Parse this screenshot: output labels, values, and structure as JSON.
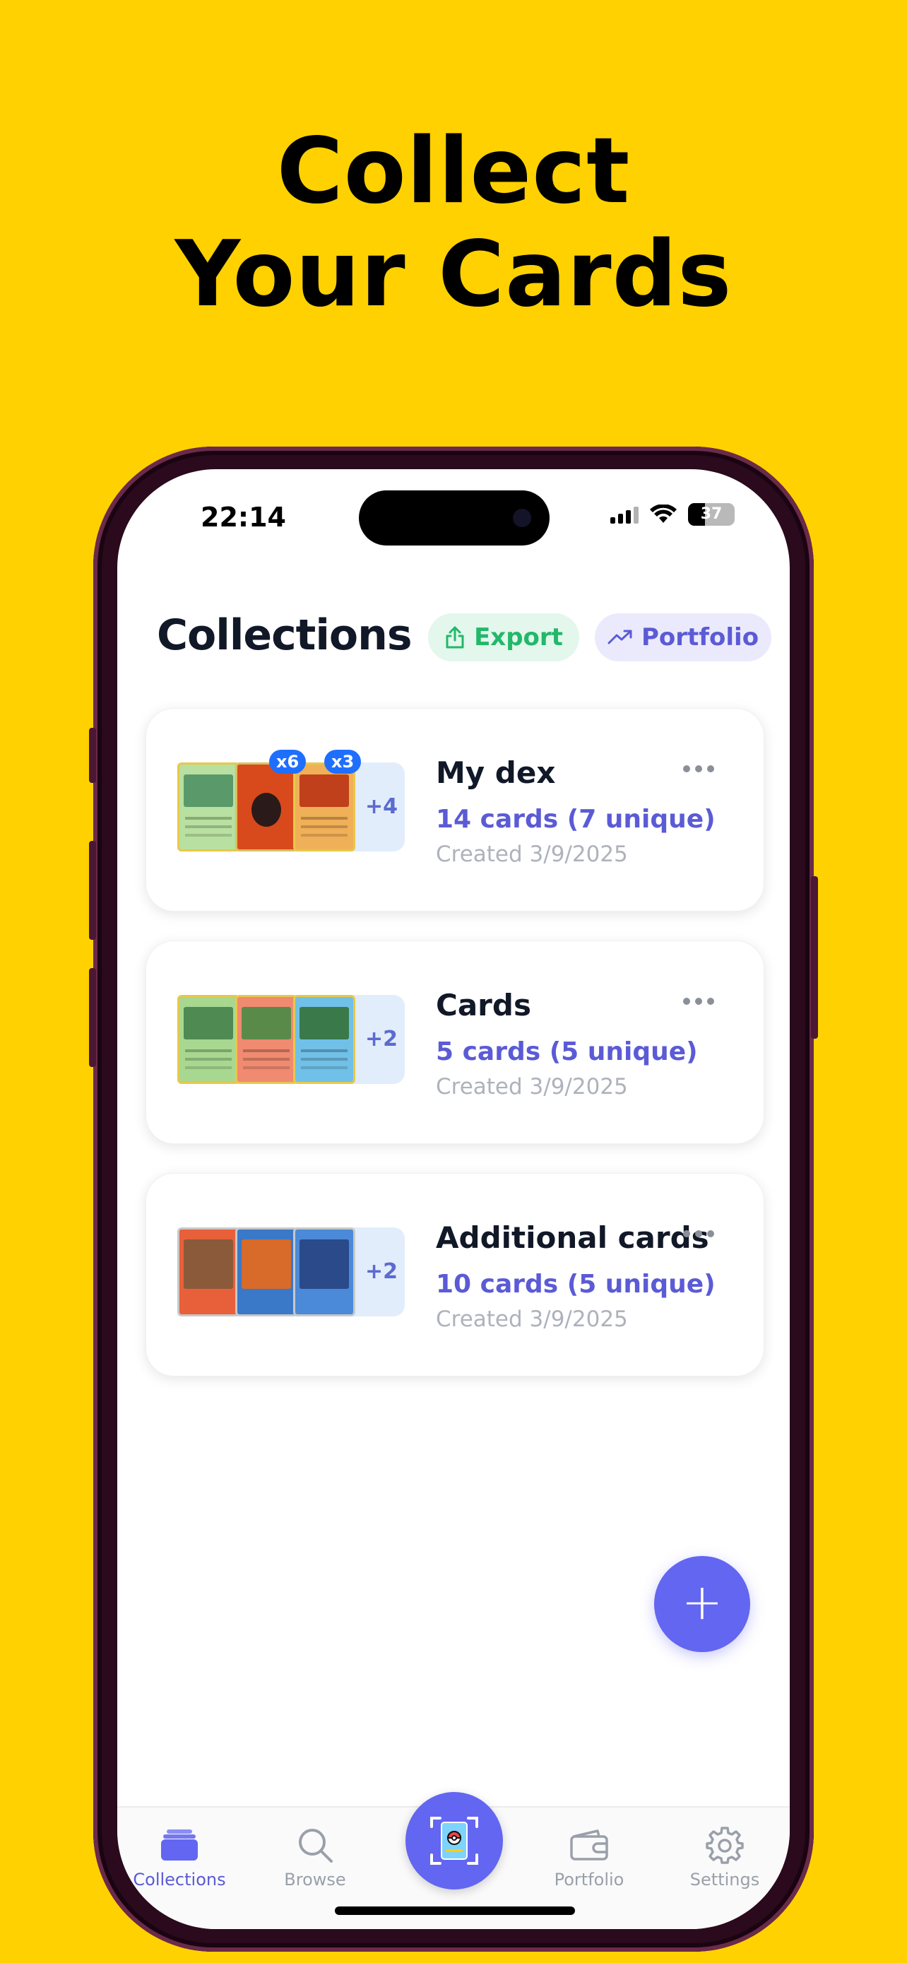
{
  "headline": {
    "line1": "Collect",
    "line2": "Your Cards"
  },
  "status_bar": {
    "time": "22:14",
    "battery": "37",
    "battery_level": 0.37
  },
  "header": {
    "title": "Collections",
    "export_label": "Export",
    "portfolio_label": "Portfolio"
  },
  "collections": [
    {
      "name": "My dex",
      "count": "14 cards (7 unique)",
      "created": "Created 3/9/2025",
      "more": "+4",
      "badges": [
        "x6",
        "x3"
      ]
    },
    {
      "name": "Cards",
      "count": "5 cards (5 unique)",
      "created": "Created 3/9/2025",
      "more": "+2"
    },
    {
      "name": "Additional cards",
      "count": "10 cards (5 unique)",
      "created": "Created 3/9/2025",
      "more": "+2"
    }
  ],
  "fab_label": "+",
  "tabs": [
    {
      "label": "Collections",
      "icon": "collections-icon",
      "active": true
    },
    {
      "label": "Browse",
      "icon": "search-icon"
    },
    {
      "label": "",
      "icon": "scan-card-icon"
    },
    {
      "label": "Portfolio",
      "icon": "wallet-icon"
    },
    {
      "label": "Settings",
      "icon": "gear-icon"
    }
  ],
  "colors": {
    "background": "#FFD100",
    "accent": "#6366F1",
    "export_green": "#22B86A"
  }
}
